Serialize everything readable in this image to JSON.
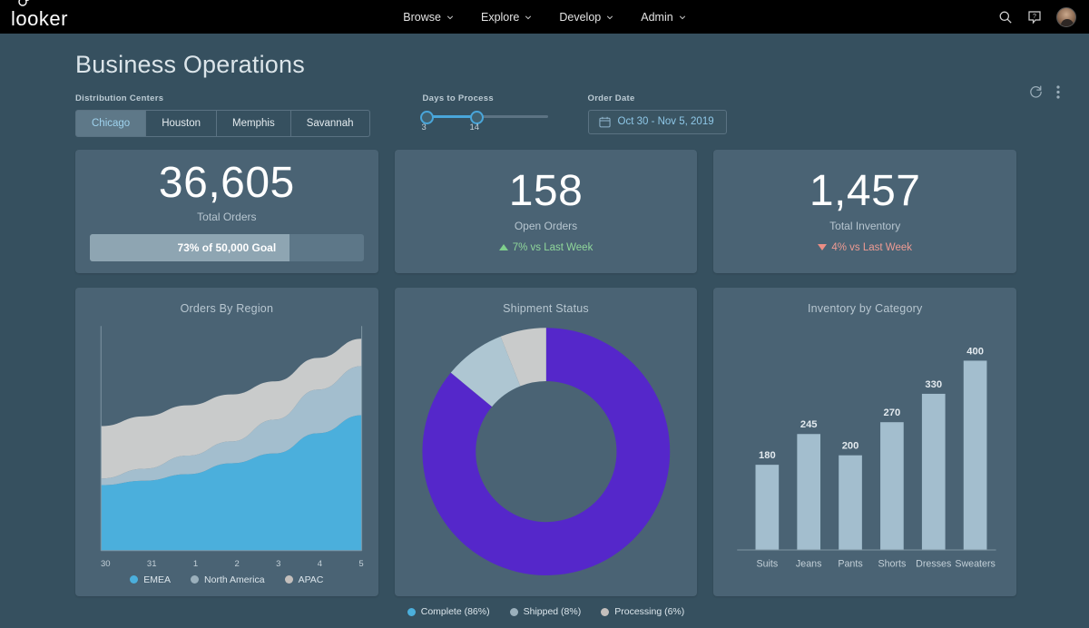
{
  "nav": {
    "logo_text": "looker",
    "items": [
      {
        "label": "Browse",
        "icon": "chevron-down-icon"
      },
      {
        "label": "Explore",
        "icon": "chevron-down-icon"
      },
      {
        "label": "Develop",
        "icon": "chevron-down-icon"
      },
      {
        "label": "Admin",
        "icon": "chevron-down-icon"
      }
    ],
    "right_icons": [
      "search-icon",
      "help-icon",
      "avatar"
    ]
  },
  "header": {
    "title": "Business Operations",
    "actions": [
      "refresh-icon",
      "more-options-icon"
    ]
  },
  "filters": {
    "distribution_centers": {
      "label": "Distribution Centers",
      "options": [
        "Chicago",
        "Houston",
        "Memphis",
        "Savannah"
      ],
      "selected": "Chicago"
    },
    "days_to_process": {
      "label": "Days to Process",
      "min_value": "3",
      "max_value": "14"
    },
    "order_date": {
      "label": "Order Date",
      "value": "Oct 30 - Nov 5, 2019",
      "icon": "calendar-icon"
    }
  },
  "kpis": [
    {
      "value": "36,605",
      "label": "Total Orders",
      "progress_text": "73% of 50,000 Goal",
      "progress_pct": 73
    },
    {
      "value": "158",
      "label": "Open Orders",
      "delta": "7% vs Last Week",
      "delta_direction": "up",
      "delta_color": "#8FD69A"
    },
    {
      "value": "1,457",
      "label": "Total Inventory",
      "delta": "4% vs Last Week",
      "delta_direction": "down",
      "delta_color": "#EE9B93"
    }
  ],
  "chart_data": [
    {
      "type": "area",
      "title": "Orders By Region",
      "stacked": true,
      "x": [
        "30",
        "31",
        "1",
        "2",
        "3",
        "4",
        "5"
      ],
      "xlabel": "",
      "ylabel": "",
      "grid": false,
      "legend_position": "bottom",
      "series": [
        {
          "name": "EMEA",
          "color": "#4BAFDC",
          "values": [
            120,
            128,
            140,
            160,
            178,
            215,
            248
          ]
        },
        {
          "name": "North America",
          "color": "#A3BECE",
          "values": [
            12,
            22,
            34,
            40,
            62,
            80,
            90
          ]
        },
        {
          "name": "APAC",
          "color": "#C9CBCB",
          "values": [
            96,
            96,
            92,
            86,
            70,
            58,
            50
          ]
        }
      ]
    },
    {
      "type": "pie",
      "title": "Shipment Status",
      "donut": true,
      "legend_position": "bottom",
      "labels": [
        "Complete",
        "Shipped",
        "Processing"
      ],
      "values": [
        86,
        8,
        6
      ],
      "legend_labels": [
        "Complete (86%)",
        "Shipped (8%)",
        "Processing (6%)"
      ],
      "slice_colors": [
        "#5527CA",
        "#AEC6D2",
        "#C9CBCB"
      ],
      "legend_dot_colors": [
        "#4BAFDC",
        "#9BB0BC",
        "#C4BFBC"
      ]
    },
    {
      "type": "bar",
      "title": "Inventory by Category",
      "categories": [
        "Suits",
        "Jeans",
        "Pants",
        "Shorts",
        "Dresses",
        "Sweaters"
      ],
      "values": [
        180,
        245,
        200,
        270,
        330,
        400
      ],
      "value_labels": [
        "180",
        "245",
        "200",
        "270",
        "330",
        "400"
      ],
      "bar_color": "#A3BECE",
      "ylim": [
        0,
        430
      ],
      "xlabel": "",
      "ylabel": "",
      "grid": false
    }
  ],
  "colors": {
    "page_background": "#36505F",
    "tile_background": "#4A6374",
    "nav_background": "#000000",
    "accent_blue": "#49A6DA",
    "accent_purple": "#5527CA",
    "positive": "#8FD69A",
    "negative": "#EE9B93"
  }
}
